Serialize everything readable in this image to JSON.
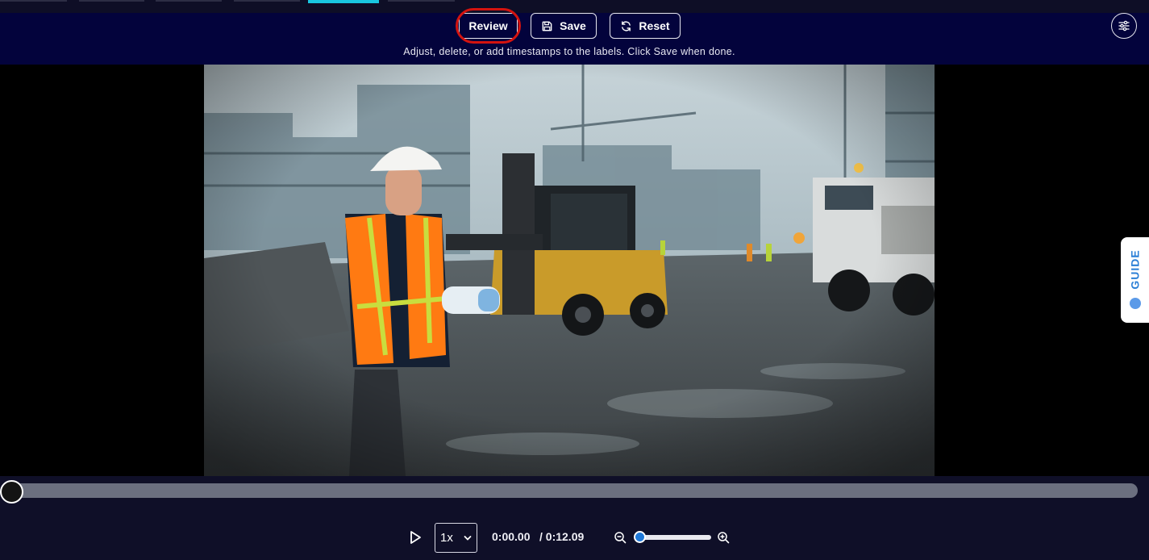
{
  "header": {
    "review_label": "Review",
    "save_label": "Save",
    "reset_label": "Reset",
    "instructions": "Adjust, delete, or add timestamps to the labels. Click Save when done."
  },
  "guide": {
    "label": "GUIDE"
  },
  "player": {
    "speed": "1x",
    "current_time": "0:00.00",
    "total_time": "/ 0:12.09",
    "progress": 0,
    "zoom_level": 0
  },
  "colors": {
    "header_bg": "#03033c",
    "active_tab": "#19c6e0",
    "highlight_ring": "#d4130f",
    "guide_text": "#2b7fd6",
    "zoom_thumb": "#1e78d8"
  }
}
